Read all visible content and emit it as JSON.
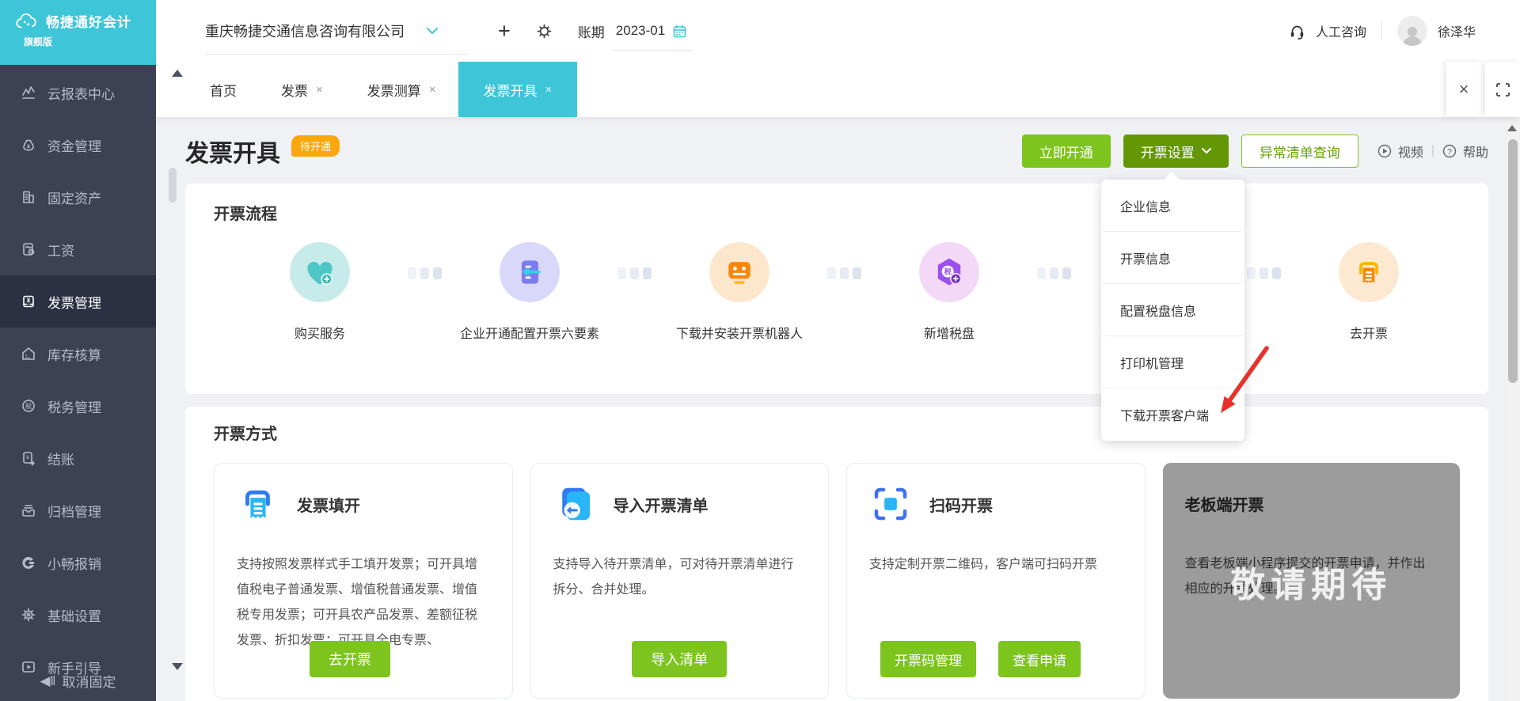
{
  "colors": {
    "brand_teal": "#3ec5d8",
    "sidebar_bg": "#3d4154",
    "sidebar_active_bg": "#2c3042",
    "green": "#7dc41e",
    "dark_green": "#649704",
    "badge_orange": "#faa70e",
    "red_arrow": "#e8312a",
    "page_bg": "#f0f1f5",
    "card_disabled_bg": "#9c9c9c"
  },
  "brand": {
    "name": "畅捷通好会计",
    "edition": "旗舰版"
  },
  "topbar": {
    "company": "重庆畅捷交通信息咨询有限公司",
    "add": "+",
    "period_label": "账期",
    "period_value": "2023-01",
    "support": "人工咨询",
    "user": "徐泽华"
  },
  "window": {
    "close": "×"
  },
  "tabs": [
    {
      "label": "首页"
    },
    {
      "label": "发票",
      "close": "×"
    },
    {
      "label": "发票测算",
      "close": "×"
    },
    {
      "label": "发票开具",
      "close": "×"
    }
  ],
  "sidebar": {
    "items": [
      {
        "label": "云报表中心"
      },
      {
        "label": "资金管理"
      },
      {
        "label": "固定资产"
      },
      {
        "label": "工资"
      },
      {
        "label": "发票管理"
      },
      {
        "label": "库存核算"
      },
      {
        "label": "税务管理"
      },
      {
        "label": "结账"
      },
      {
        "label": "归档管理"
      },
      {
        "label": "小畅报销"
      },
      {
        "label": "基础设置"
      },
      {
        "label": "新手引导"
      }
    ],
    "footer": "取消固定"
  },
  "page": {
    "title": "发票开具",
    "badge": "待开通",
    "activate": "立即开通",
    "settings": "开票设置",
    "abnormal": "异常清单查询",
    "video": "视频",
    "help": "帮助"
  },
  "settings_menu": {
    "items": [
      {
        "label": "企业信息"
      },
      {
        "label": "开票信息"
      },
      {
        "label": "配置税盘信息"
      },
      {
        "label": "打印机管理"
      },
      {
        "label": "下载开票客户端"
      }
    ]
  },
  "flow": {
    "title": "开票流程",
    "steps": [
      {
        "label": "购买服务"
      },
      {
        "label": "企业开通配置开票六要素"
      },
      {
        "label": "下载并安装开票机器人"
      },
      {
        "label": "新增税盘"
      },
      {
        "label": "去开票"
      }
    ]
  },
  "methods": {
    "title": "开票方式",
    "cards": [
      {
        "title": "发票填开",
        "desc": "支持按照发票样式手工填开发票；可开具增值税电子普通发票、增值税普通发票、增值税专用发票；可开具农产品发票、差额征税发票、折扣发票；可开具全电专票、",
        "button": "去开票"
      },
      {
        "title": "导入开票清单",
        "desc": "支持导入待开票清单，可对待开票清单进行拆分、合并处理。",
        "button": "导入清单"
      },
      {
        "title": "扫码开票",
        "desc": "支持定制开票二维码，客户端可扫码开票",
        "button1": "开票码管理",
        "button2": "查看申请"
      },
      {
        "title": "老板端开票",
        "desc": "查看老板端小程序提交的开票申请，并作出相应的开票处理。",
        "watermark": "敬请期待"
      }
    ]
  }
}
